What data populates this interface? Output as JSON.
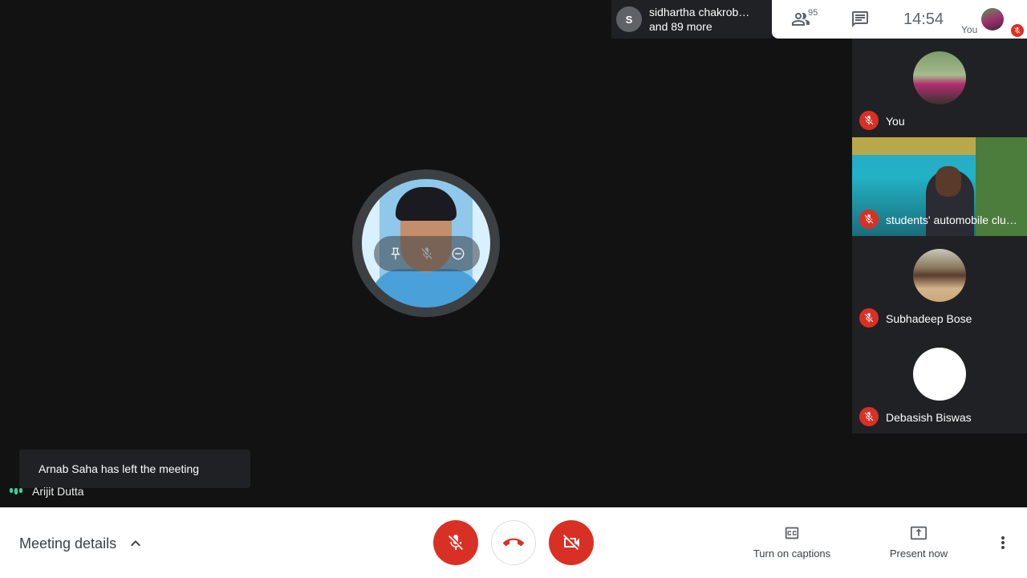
{
  "top_chip": {
    "avatar_letter": "S",
    "line1": "sidhartha chakrob…",
    "line2": "and 89 more"
  },
  "top_bar": {
    "people_count": "95",
    "clock": "14:54",
    "you_label": "You"
  },
  "tiles": [
    {
      "name": "You"
    },
    {
      "name": "students' automobile clu…"
    },
    {
      "name": "Subhadeep Bose"
    },
    {
      "name": "Debasish Biswas"
    }
  ],
  "toast": "Arnab Saha has left the meeting",
  "active_speaker": "Arijit Dutta",
  "bottom": {
    "meeting_details": "Meeting details",
    "captions": "Turn on captions",
    "present": "Present now"
  },
  "colors": {
    "danger": "#d93025",
    "panel": "#202124",
    "stage": "#121212",
    "speaking": "#34d399"
  },
  "icons": [
    "people-icon",
    "chat-icon",
    "mic-off-icon",
    "pin-icon",
    "minus-circle-icon",
    "call-end-icon",
    "videocam-off-icon",
    "captions-icon",
    "present-icon",
    "more-vert-icon",
    "chevron-up-icon"
  ]
}
